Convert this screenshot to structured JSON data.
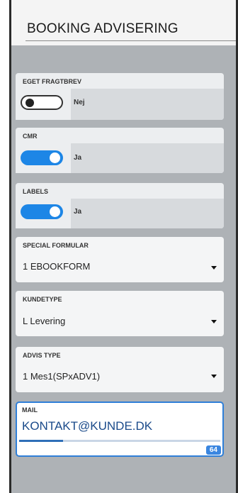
{
  "header": {
    "title": "BOOKING ADVISERING"
  },
  "fields": {
    "eget_fragtbrev": {
      "label": "EGET FRAGTBREV",
      "state": "off",
      "value_text": "Nej"
    },
    "cmr": {
      "label": "CMR",
      "state": "on",
      "value_text": "Ja"
    },
    "labels": {
      "label": "LABELS",
      "state": "on",
      "value_text": "Ja"
    },
    "special_formular": {
      "label": "SPECIAL FORMULAR",
      "value": "1 EBOOKFORM"
    },
    "kundetype": {
      "label": "KUNDETYPE",
      "value": "L Levering"
    },
    "advis_type": {
      "label": "ADVIS TYPE",
      "value": "1 Mes1(SPxADV1)"
    },
    "mail": {
      "label": "MAIL",
      "value": "KONTAKT@KUNDE.DK",
      "remaining": "64",
      "progress_fraction": 0.22
    }
  },
  "colors": {
    "panel_bg": "#aeb2b6",
    "accent": "#1d86e6",
    "focus_border": "#2f7fd8"
  },
  "icons": {
    "select_caret": "caret-down-icon"
  }
}
